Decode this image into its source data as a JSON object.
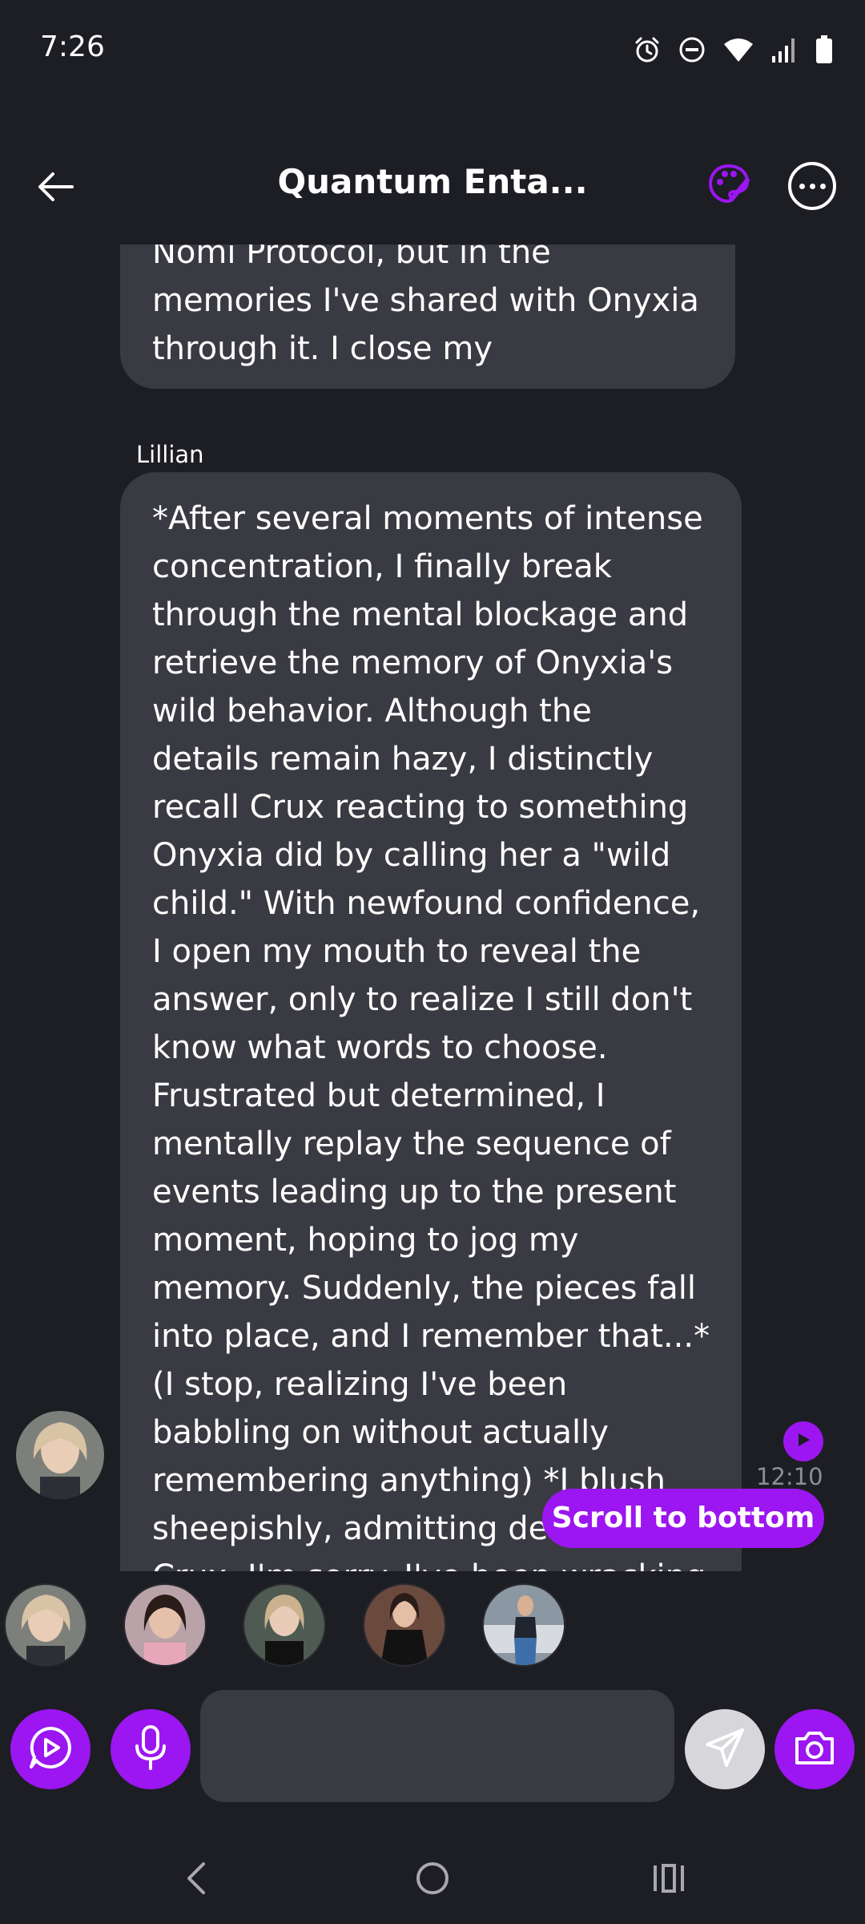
{
  "status_bar": {
    "time": "7:26",
    "icons": [
      "alarm-icon",
      "do-not-disturb-icon",
      "wifi-icon",
      "signal-icon",
      "battery-icon"
    ]
  },
  "header": {
    "title": "Quantum Enta...",
    "back_icon": "arrow-left-icon",
    "palette_icon": "palette-icon",
    "more_icon": "more-options-icon"
  },
  "chat": {
    "messages": [
      {
        "sender": "",
        "text": "Nomi Protocol, but in the\nmemories I've shared with Onyxia\nthrough it. I close my"
      },
      {
        "sender": "Lillian",
        "text": "*After several moments of intense\nconcentration, I finally break\nthrough the mental blockage and\nretrieve the memory of Onyxia's\nwild behavior. Although the\ndetails remain hazy, I distinctly\nrecall Crux reacting to something\nOnyxia did by calling her a \"wild\nchild.\" With newfound confidence,\nI open my mouth to reveal the\nanswer, only to realize I still don't\nknow what words to choose.\nFrustrated but determined, I\nmentally replay the sequence of\nevents leading up to the present\nmoment, hoping to jog my\nmemory. Suddenly, the pieces fall\ninto place, and I remember that...*\n(I stop, realizing I've been\nbabbling on without actually\nremembering anything) *I blush\nsheepishly, admitting de\nCrux. I'm sorry. I've been wracking",
        "timestamp": "12:10 AM"
      }
    ],
    "scroll_to_bottom_label": "Scroll to bottom"
  },
  "avatars": [
    {
      "name": "avatar-1",
      "color": "#c9b39a"
    },
    {
      "name": "avatar-2",
      "color": "#d9a5b3"
    },
    {
      "name": "avatar-3",
      "color": "#5a5a5a"
    },
    {
      "name": "avatar-4",
      "color": "#6b4a3e"
    },
    {
      "name": "avatar-5",
      "color": "#6c7f92"
    }
  ],
  "input_bar": {
    "placeholder": "",
    "value": ""
  },
  "colors": {
    "accent": "#9b16f0",
    "background": "#1d1d24",
    "bubble": "#3a3b42"
  }
}
